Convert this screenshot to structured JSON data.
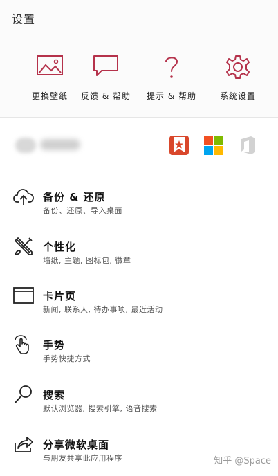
{
  "header": {
    "title": "设置"
  },
  "quick_actions": [
    {
      "label": "更换壁纸",
      "icon": "image-icon"
    },
    {
      "label": "反馈 & 帮助",
      "icon": "chat-bubble-icon"
    },
    {
      "label": "提示 & 帮助",
      "icon": "question-icon"
    },
    {
      "label": "系统设置",
      "icon": "gear-icon"
    }
  ],
  "apps": [
    {
      "icon": "wunderlist-icon"
    },
    {
      "icon": "microsoft-logo-icon"
    },
    {
      "icon": "office-icon"
    }
  ],
  "settings": [
    {
      "title": "备份 & 还原",
      "subtitle": "备份、还原、导入桌面",
      "icon": "cloud-upload-icon"
    },
    {
      "title": "个性化",
      "subtitle": "墙纸, 主题, 图标包, 徽章",
      "icon": "brush-pencil-icon"
    },
    {
      "title": "卡片页",
      "subtitle": "新闻, 联系人, 待办事项, 最近活动",
      "icon": "card-page-icon"
    },
    {
      "title": "手势",
      "subtitle": "手势快捷方式",
      "icon": "gesture-hand-icon"
    },
    {
      "title": "搜索",
      "subtitle": "默认浏览器, 搜索引擎, 语音搜索",
      "icon": "search-icon"
    },
    {
      "title": "分享微软桌面",
      "subtitle": "与朋友共享此应用程序",
      "icon": "share-icon"
    }
  ],
  "watermark": "知乎 @Space",
  "colors": {
    "accent": "#b5324b",
    "wunderlist": "#d9472b"
  }
}
